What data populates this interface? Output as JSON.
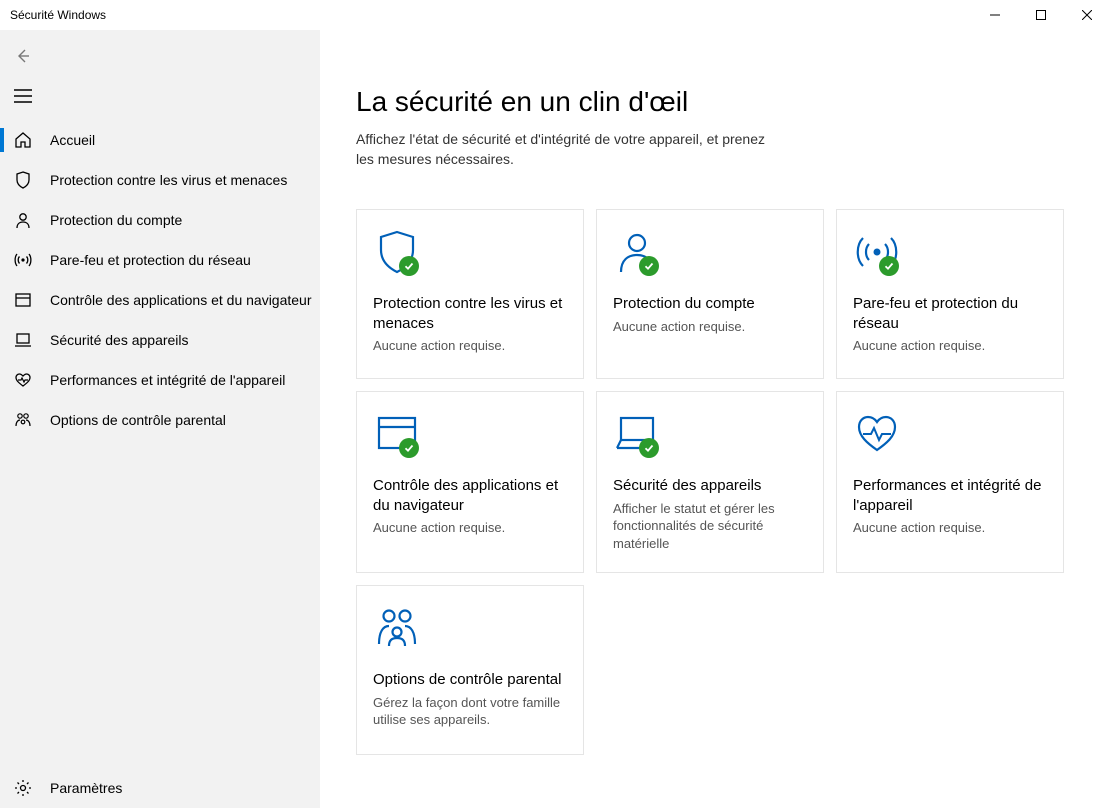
{
  "window": {
    "title": "Sécurité Windows"
  },
  "sidebar": {
    "items": [
      {
        "label": "Accueil",
        "icon": "home"
      },
      {
        "label": "Protection contre les virus et menaces",
        "icon": "shield"
      },
      {
        "label": "Protection du compte",
        "icon": "person"
      },
      {
        "label": "Pare-feu et protection du réseau",
        "icon": "antenna"
      },
      {
        "label": "Contrôle des applications et du navigateur",
        "icon": "app"
      },
      {
        "label": "Sécurité des appareils",
        "icon": "device"
      },
      {
        "label": "Performances et intégrité de l'appareil",
        "icon": "heart"
      },
      {
        "label": "Options de contrôle parental",
        "icon": "family"
      }
    ],
    "selected": 0,
    "settings_label": "Paramètres"
  },
  "main": {
    "title": "La sécurité en un clin d'œil",
    "subtitle": "Affichez l'état de sécurité et d'intégrité de votre appareil, et prenez les mesures nécessaires.",
    "cards": [
      {
        "icon": "shield",
        "title": "Protection contre les virus et menaces",
        "desc": "Aucune action requise.",
        "check": true
      },
      {
        "icon": "person",
        "title": "Protection du compte",
        "desc": "Aucune action requise.",
        "check": true
      },
      {
        "icon": "antenna",
        "title": "Pare-feu et protection du réseau",
        "desc": "Aucune action requise.",
        "check": true
      },
      {
        "icon": "app",
        "title": "Contrôle des applications et du navigateur",
        "desc": "Aucune action requise.",
        "check": true
      },
      {
        "icon": "device",
        "title": "Sécurité des appareils",
        "desc": "Afficher le statut et gérer les fonctionnalités de sécurité matérielle",
        "check": true
      },
      {
        "icon": "heart",
        "title": "Performances et intégrité de l'appareil",
        "desc": "Aucune action requise.",
        "check": false
      },
      {
        "icon": "family",
        "title": "Options de contrôle parental",
        "desc": "Gérez la façon dont votre famille utilise ses appareils.",
        "check": false
      }
    ]
  }
}
